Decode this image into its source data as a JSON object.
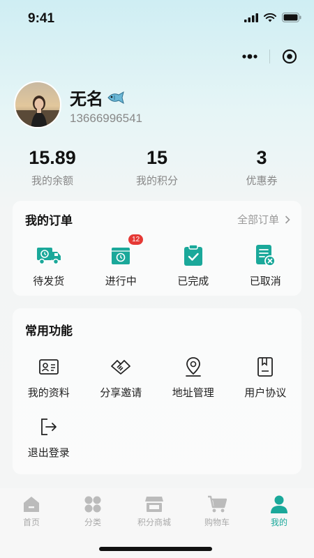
{
  "status_bar": {
    "time": "9:41"
  },
  "profile": {
    "name": "无名",
    "phone": "13666996541"
  },
  "stats": [
    {
      "value": "15.89",
      "label": "我的余额"
    },
    {
      "value": "15",
      "label": "我的积分"
    },
    {
      "value": "3",
      "label": "优惠券"
    }
  ],
  "orders": {
    "title": "我的订单",
    "all_link": "全部订单",
    "items": [
      {
        "label": "待发货",
        "icon": "truck-icon"
      },
      {
        "label": "进行中",
        "icon": "package-clock-icon",
        "badge": "12"
      },
      {
        "label": "已完成",
        "icon": "clipboard-check-icon"
      },
      {
        "label": "已取消",
        "icon": "document-cancel-icon"
      }
    ]
  },
  "functions": {
    "title": "常用功能",
    "items": [
      {
        "label": "我的资料",
        "icon": "id-card-icon"
      },
      {
        "label": "分享邀请",
        "icon": "handshake-icon"
      },
      {
        "label": "地址管理",
        "icon": "location-pin-icon"
      },
      {
        "label": "用户协议",
        "icon": "agreement-book-icon"
      },
      {
        "label": "退出登录",
        "icon": "logout-icon"
      }
    ]
  },
  "tabbar": [
    {
      "label": "首页",
      "icon": "home-icon"
    },
    {
      "label": "分类",
      "icon": "category-icon"
    },
    {
      "label": "积分商城",
      "icon": "store-icon"
    },
    {
      "label": "购物车",
      "icon": "cart-icon"
    },
    {
      "label": "我的",
      "icon": "user-icon",
      "active": true
    }
  ],
  "colors": {
    "accent": "#1aa89a",
    "badge": "#e53935",
    "inactive": "#aaaaaa"
  }
}
